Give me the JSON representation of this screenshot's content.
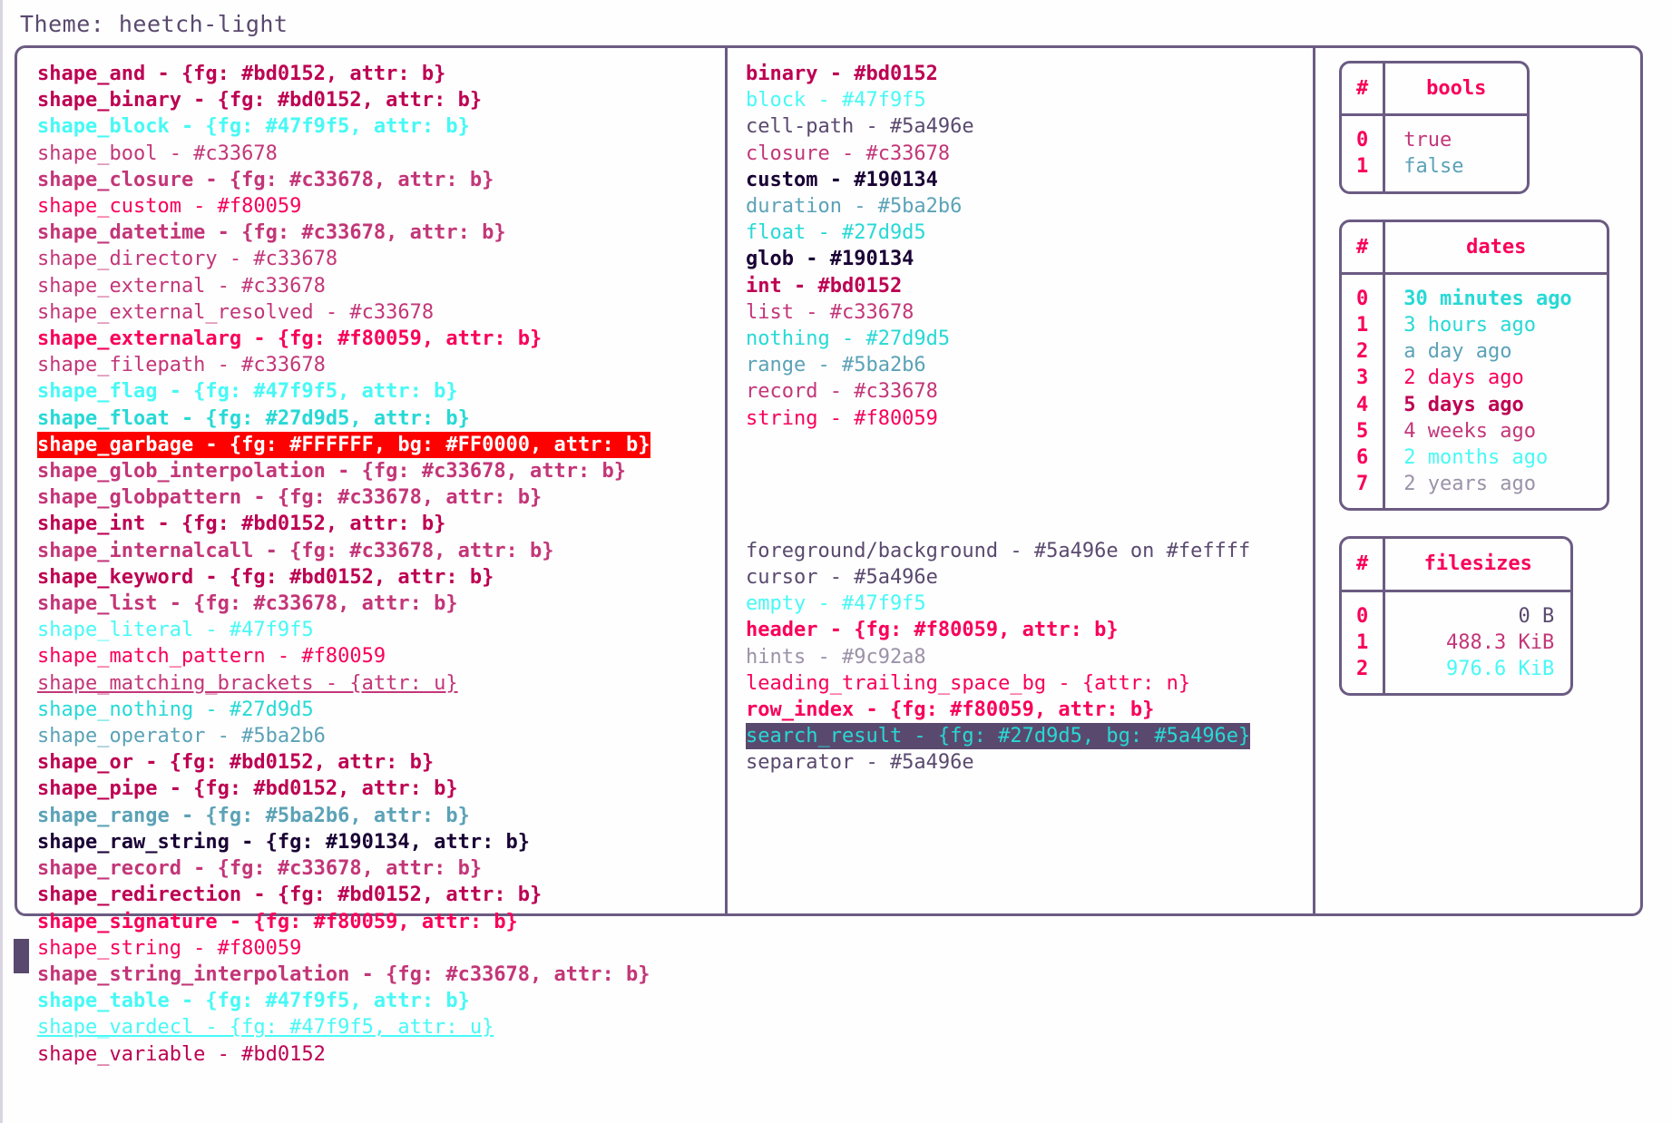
{
  "header": {
    "theme_label": "Theme: heetch-light"
  },
  "colors": {
    "accent_pink": "#f80059",
    "crimson": "#bd0152",
    "magenta": "#c33678",
    "cyan": "#47f9f5",
    "teal": "#27d9d5",
    "steel": "#5ba2b6",
    "slate": "#5a496e",
    "dark": "#190134",
    "grey": "#9c92a8",
    "background": "#fefeff",
    "border": "#6b5b82",
    "garbage_fg": "#FFFFFF",
    "garbage_bg": "#FF0000",
    "search_fg": "#27d9d5",
    "search_bg": "#5a496e"
  },
  "shapes": [
    {
      "text": "shape_and - {fg: #bd0152, attr: b}",
      "fg": "#bd0152",
      "bold": true
    },
    {
      "text": "shape_binary - {fg: #bd0152, attr: b}",
      "fg": "#bd0152",
      "bold": true
    },
    {
      "text": "shape_block - {fg: #47f9f5, attr: b}",
      "fg": "#47f9f5",
      "bold": true
    },
    {
      "text": "shape_bool - #c33678",
      "fg": "#c33678",
      "bold": false
    },
    {
      "text": "shape_closure - {fg: #c33678, attr: b}",
      "fg": "#c33678",
      "bold": true
    },
    {
      "text": "shape_custom - #f80059",
      "fg": "#f80059",
      "bold": false
    },
    {
      "text": "shape_datetime - {fg: #c33678, attr: b}",
      "fg": "#c33678",
      "bold": true
    },
    {
      "text": "shape_directory - #c33678",
      "fg": "#c33678",
      "bold": false
    },
    {
      "text": "shape_external - #c33678",
      "fg": "#c33678",
      "bold": false
    },
    {
      "text": "shape_external_resolved - #c33678",
      "fg": "#c33678",
      "bold": false
    },
    {
      "text": "shape_externalarg - {fg: #f80059, attr: b}",
      "fg": "#f80059",
      "bold": true
    },
    {
      "text": "shape_filepath - #c33678",
      "fg": "#c33678",
      "bold": false
    },
    {
      "text": "shape_flag - {fg: #47f9f5, attr: b}",
      "fg": "#47f9f5",
      "bold": true
    },
    {
      "text": "shape_float - {fg: #27d9d5, attr: b}",
      "fg": "#27d9d5",
      "bold": true
    },
    {
      "text": "shape_garbage - {fg: #FFFFFF, bg: #FF0000, attr: b}",
      "fg": "#FFFFFF",
      "bg": "#FF0000",
      "bold": true
    },
    {
      "text": "shape_glob_interpolation - {fg: #c33678, attr: b}",
      "fg": "#c33678",
      "bold": true
    },
    {
      "text": "shape_globpattern - {fg: #c33678, attr: b}",
      "fg": "#c33678",
      "bold": true
    },
    {
      "text": "shape_int - {fg: #bd0152, attr: b}",
      "fg": "#bd0152",
      "bold": true
    },
    {
      "text": "shape_internalcall - {fg: #c33678, attr: b}",
      "fg": "#c33678",
      "bold": true
    },
    {
      "text": "shape_keyword - {fg: #bd0152, attr: b}",
      "fg": "#bd0152",
      "bold": true
    },
    {
      "text": "shape_list - {fg: #c33678, attr: b}",
      "fg": "#c33678",
      "bold": true
    },
    {
      "text": "shape_literal - #47f9f5",
      "fg": "#47f9f5",
      "bold": false
    },
    {
      "text": "shape_match_pattern - #f80059",
      "fg": "#f80059",
      "bold": false
    },
    {
      "text": "shape_matching_brackets - {attr: u}",
      "fg": "#c33678",
      "bold": false,
      "underline": true
    },
    {
      "text": "shape_nothing - #27d9d5",
      "fg": "#27d9d5",
      "bold": false
    },
    {
      "text": "shape_operator - #5ba2b6",
      "fg": "#5ba2b6",
      "bold": false
    },
    {
      "text": "shape_or - {fg: #bd0152, attr: b}",
      "fg": "#bd0152",
      "bold": true
    },
    {
      "text": "shape_pipe - {fg: #bd0152, attr: b}",
      "fg": "#bd0152",
      "bold": true
    },
    {
      "text": "shape_range - {fg: #5ba2b6, attr: b}",
      "fg": "#5ba2b6",
      "bold": true
    },
    {
      "text": "shape_raw_string - {fg: #190134, attr: b}",
      "fg": "#190134",
      "bold": true
    },
    {
      "text": "shape_record - {fg: #c33678, attr: b}",
      "fg": "#c33678",
      "bold": true
    },
    {
      "text": "shape_redirection - {fg: #bd0152, attr: b}",
      "fg": "#bd0152",
      "bold": true
    },
    {
      "text": "shape_signature - {fg: #f80059, attr: b}",
      "fg": "#f80059",
      "bold": true
    },
    {
      "text": "shape_string - #f80059",
      "fg": "#f80059",
      "bold": false
    },
    {
      "text": "shape_string_interpolation - {fg: #c33678, attr: b}",
      "fg": "#c33678",
      "bold": true
    },
    {
      "text": "shape_table - {fg: #47f9f5, attr: b}",
      "fg": "#47f9f5",
      "bold": true
    },
    {
      "text": "shape_vardecl - {fg: #47f9f5, attr: u}",
      "fg": "#47f9f5",
      "bold": false,
      "underline": true
    },
    {
      "text": "shape_variable - #bd0152",
      "fg": "#bd0152",
      "bold": false
    }
  ],
  "types": [
    {
      "text": "binary - #bd0152",
      "fg": "#bd0152",
      "bold": true
    },
    {
      "text": "block - #47f9f5",
      "fg": "#47f9f5",
      "bold": false
    },
    {
      "text": "cell-path - #5a496e",
      "fg": "#5a496e",
      "bold": false
    },
    {
      "text": "closure - #c33678",
      "fg": "#c33678",
      "bold": false
    },
    {
      "text": "custom - #190134",
      "fg": "#190134",
      "bold": true
    },
    {
      "text": "duration - #5ba2b6",
      "fg": "#5ba2b6",
      "bold": false
    },
    {
      "text": "float - #27d9d5",
      "fg": "#27d9d5",
      "bold": false
    },
    {
      "text": "glob - #190134",
      "fg": "#190134",
      "bold": true
    },
    {
      "text": "int - #bd0152",
      "fg": "#bd0152",
      "bold": true
    },
    {
      "text": "list - #c33678",
      "fg": "#c33678",
      "bold": false
    },
    {
      "text": "nothing - #27d9d5",
      "fg": "#27d9d5",
      "bold": false
    },
    {
      "text": "range - #5ba2b6",
      "fg": "#5ba2b6",
      "bold": false
    },
    {
      "text": "record - #c33678",
      "fg": "#c33678",
      "bold": false
    },
    {
      "text": "string - #f80059",
      "fg": "#f80059",
      "bold": false
    }
  ],
  "ui_elements": [
    {
      "text": "foreground/background - #5a496e on #feffff",
      "fg": "#5a496e",
      "bold": false
    },
    {
      "text": "cursor - #5a496e",
      "fg": "#5a496e",
      "bold": false
    },
    {
      "text": "empty - #47f9f5",
      "fg": "#47f9f5",
      "bold": false
    },
    {
      "text": "header - {fg: #f80059, attr: b}",
      "fg": "#f80059",
      "bold": true
    },
    {
      "text": "hints - #9c92a8",
      "fg": "#9c92a8",
      "bold": false
    },
    {
      "text": "leading_trailing_space_bg - {attr: n}",
      "fg": "#f80059",
      "bold": false
    },
    {
      "text": "row_index - {fg: #f80059, attr: b}",
      "fg": "#f80059",
      "bold": true
    },
    {
      "text": "search_result - {fg: #27d9d5, bg: #5a496e}",
      "fg": "#27d9d5",
      "bg": "#5a496e",
      "bold": false
    },
    {
      "text": "separator - #5a496e",
      "fg": "#5a496e",
      "bold": false
    }
  ],
  "tables": [
    {
      "name": "bools",
      "headers": [
        "#",
        "bools"
      ],
      "align": "left",
      "rows": [
        {
          "index": "0",
          "value": "true",
          "fg": "#c33678",
          "bold": false
        },
        {
          "index": "1",
          "value": "false",
          "fg": "#5ba2b6",
          "bold": false
        }
      ]
    },
    {
      "name": "dates",
      "headers": [
        "#",
        "dates"
      ],
      "align": "left",
      "rows": [
        {
          "index": "0",
          "value": "30 minutes ago",
          "fg": "#27d9d5",
          "bold": true
        },
        {
          "index": "1",
          "value": "3 hours ago",
          "fg": "#27d9d5",
          "bold": false
        },
        {
          "index": "2",
          "value": "a day ago",
          "fg": "#5ba2b6",
          "bold": false
        },
        {
          "index": "3",
          "value": "2 days ago",
          "fg": "#f80059",
          "bold": false
        },
        {
          "index": "4",
          "value": "5 days ago",
          "fg": "#bd0152",
          "bold": true
        },
        {
          "index": "5",
          "value": "4 weeks ago",
          "fg": "#c33678",
          "bold": false
        },
        {
          "index": "6",
          "value": "2 months ago",
          "fg": "#47f9f5",
          "bold": false
        },
        {
          "index": "7",
          "value": "2 years ago",
          "fg": "#9c92a8",
          "bold": false
        }
      ]
    },
    {
      "name": "filesizes",
      "headers": [
        "#",
        "filesizes"
      ],
      "align": "right",
      "rows": [
        {
          "index": "0",
          "value": "0 B",
          "fg": "#5a496e",
          "bold": false
        },
        {
          "index": "1",
          "value": "488.3 KiB",
          "fg": "#c33678",
          "bold": false
        },
        {
          "index": "2",
          "value": "976.6 KiB",
          "fg": "#47f9f5",
          "bold": false
        }
      ]
    }
  ]
}
